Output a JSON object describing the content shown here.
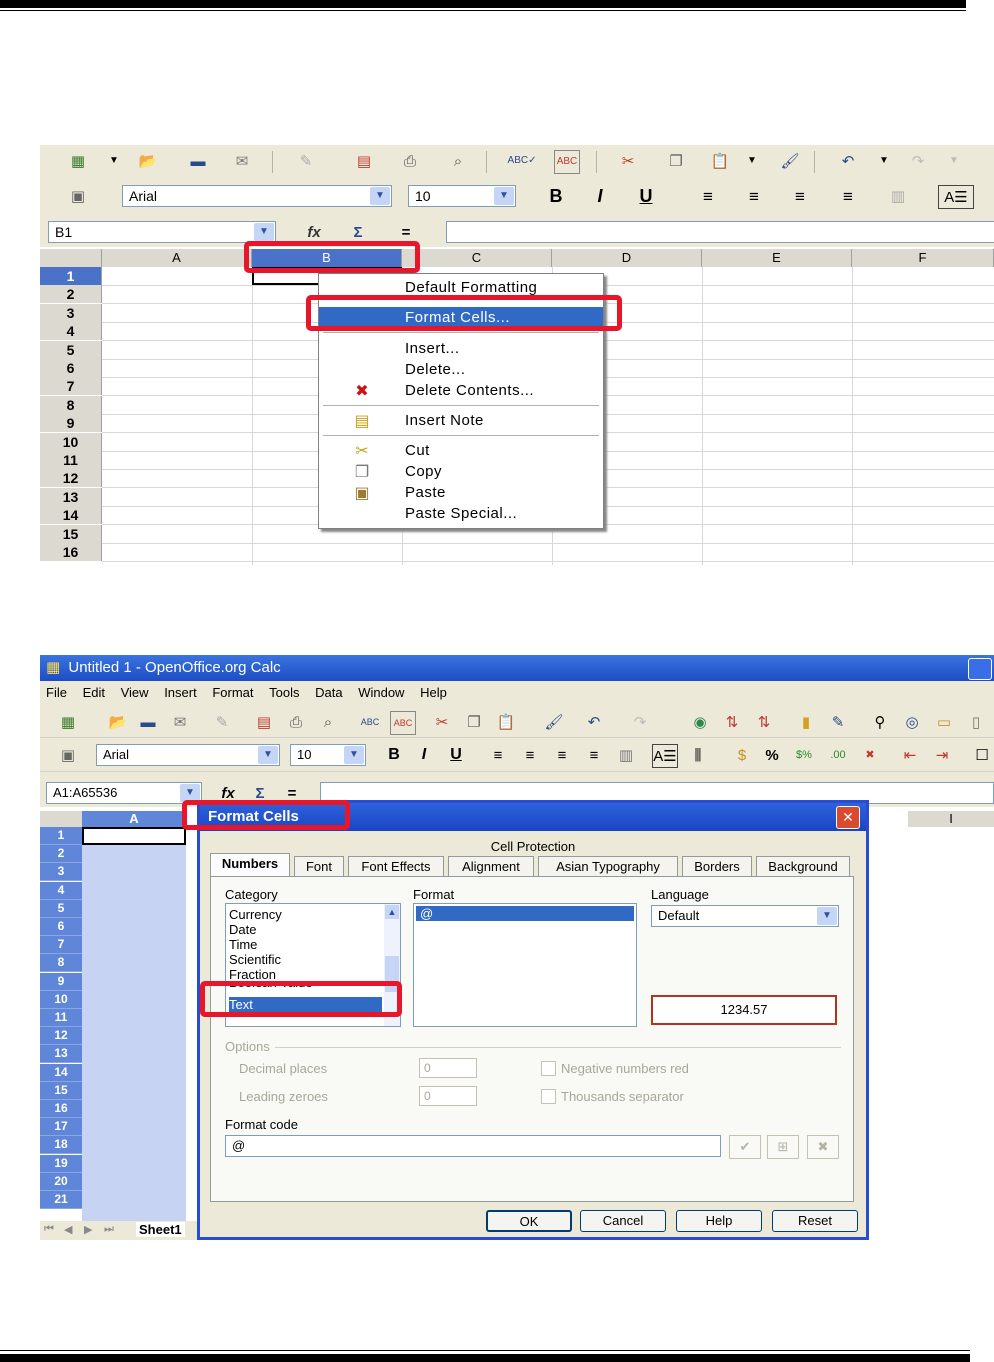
{
  "shot1": {
    "font_name": "Arial",
    "font_size": "10",
    "name_box": "B1",
    "columns": [
      "A",
      "B",
      "C",
      "D",
      "E",
      "F"
    ],
    "rows": [
      "1",
      "2",
      "3",
      "4",
      "5",
      "6",
      "7",
      "8",
      "9",
      "10",
      "11",
      "12",
      "13",
      "14",
      "15",
      "16"
    ],
    "context_menu": [
      {
        "label": "Default Formatting",
        "icon": ""
      },
      {
        "label": "Format Cells...",
        "icon": "",
        "highlighted": true
      },
      {
        "label": "Insert...",
        "icon": ""
      },
      {
        "label": "Delete...",
        "icon": ""
      },
      {
        "label": "Delete Contents...",
        "icon": "delete-x-icon"
      },
      {
        "label": "Insert Note",
        "icon": "note-icon"
      },
      {
        "label": "Cut",
        "icon": "scissors-icon"
      },
      {
        "label": "Copy",
        "icon": "copy-icon"
      },
      {
        "label": "Paste",
        "icon": "paste-icon"
      },
      {
        "label": "Paste Special...",
        "icon": ""
      }
    ]
  },
  "shot2": {
    "window_title": "Untitled 1 - OpenOffice.org Calc",
    "menu": [
      "File",
      "Edit",
      "View",
      "Insert",
      "Format",
      "Tools",
      "Data",
      "Window",
      "Help"
    ],
    "font_name": "Arial",
    "font_size": "10",
    "name_box": "A1:A65536",
    "col_a": "A",
    "col_i": "I",
    "rows": [
      "1",
      "2",
      "3",
      "4",
      "5",
      "6",
      "7",
      "8",
      "9",
      "10",
      "11",
      "12",
      "13",
      "14",
      "15",
      "16",
      "17",
      "18",
      "19",
      "20",
      "21"
    ],
    "sheet_tab": "Sheet1",
    "dialog": {
      "title": "Format Cells",
      "cell_protection_tab": "Cell Protection",
      "tabs": [
        "Numbers",
        "Font",
        "Font Effects",
        "Alignment",
        "Asian Typography",
        "Borders",
        "Background"
      ],
      "category_label": "Category",
      "categories": [
        "Currency",
        "Date",
        "Time",
        "Scientific",
        "Fraction",
        "Boolean Value",
        "Text"
      ],
      "selected_category": "Text",
      "format_label": "Format",
      "format_selected": "@",
      "language_label": "Language",
      "language_value": "Default",
      "preview": "1234.57",
      "options_label": "Options",
      "decimal_places_label": "Decimal places",
      "decimal_places_value": "0",
      "leading_zeroes_label": "Leading zeroes",
      "leading_zeroes_value": "0",
      "negative_red_label": "Negative numbers red",
      "thousands_sep_label": "Thousands separator",
      "format_code_label": "Format code",
      "format_code_value": "@",
      "buttons": {
        "ok": "OK",
        "cancel": "Cancel",
        "help": "Help",
        "reset": "Reset"
      }
    }
  },
  "colors": {
    "highlight_red": "#e8162b",
    "selection_blue": "#316ac5",
    "title_blue": "#1c4dc4"
  }
}
